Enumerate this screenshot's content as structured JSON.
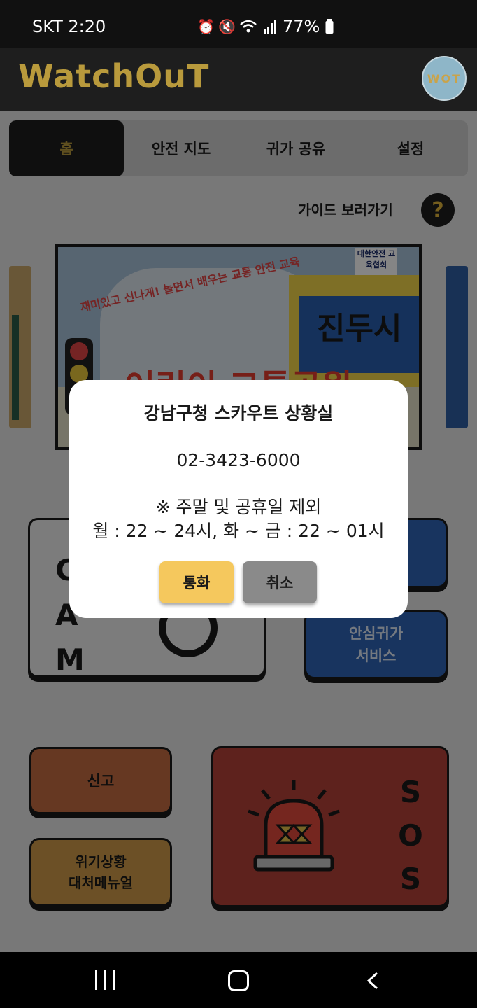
{
  "status_bar": {
    "carrier_time": "SKT 2:20",
    "battery": "77%",
    "icons": [
      "alarm-icon",
      "mute-icon",
      "wifi-icon",
      "signal-icon",
      "battery-icon"
    ]
  },
  "app_bar": {
    "title": "WatchOuT",
    "logo_text": "WOT"
  },
  "tabs": [
    {
      "label": "홈",
      "active": true
    },
    {
      "label": "안전 지도",
      "active": false
    },
    {
      "label": "귀가 공유",
      "active": false
    },
    {
      "label": "설정",
      "active": false
    }
  ],
  "guide": {
    "label": "가이드 보러가기",
    "icon_text": "?"
  },
  "banner": {
    "tag": "대한안전 교육협회",
    "subtitle": "재미있고 신나게! 놀면서 배우는 교통 안전 교육",
    "title_top": "진두시",
    "title_main": "어린이 교통공원"
  },
  "cards": {
    "cam_letters": [
      "C",
      "A",
      "M"
    ],
    "safe_return": "안심귀가\n서비스",
    "report": "신고",
    "manual": "위기상황\n대처메뉴얼",
    "sos_letters": [
      "S",
      "O",
      "S"
    ]
  },
  "dialog": {
    "title": "강남구청 스카우트 상황실",
    "phone": "02-3423-6000",
    "note": "※ 주말 및 공휴일 제외",
    "hours": "월 : 22 ~ 24시, 화 ~ 금 : 22 ~ 01시",
    "call_label": "통화",
    "cancel_label": "취소"
  },
  "colors": {
    "accent_gold": "#b99a3c",
    "dark": "#1e1e1e",
    "call_button": "#f5c85d",
    "cancel_button": "#8a8a8a",
    "blue_card": "#2f64b7",
    "sos_card": "#b54238"
  }
}
